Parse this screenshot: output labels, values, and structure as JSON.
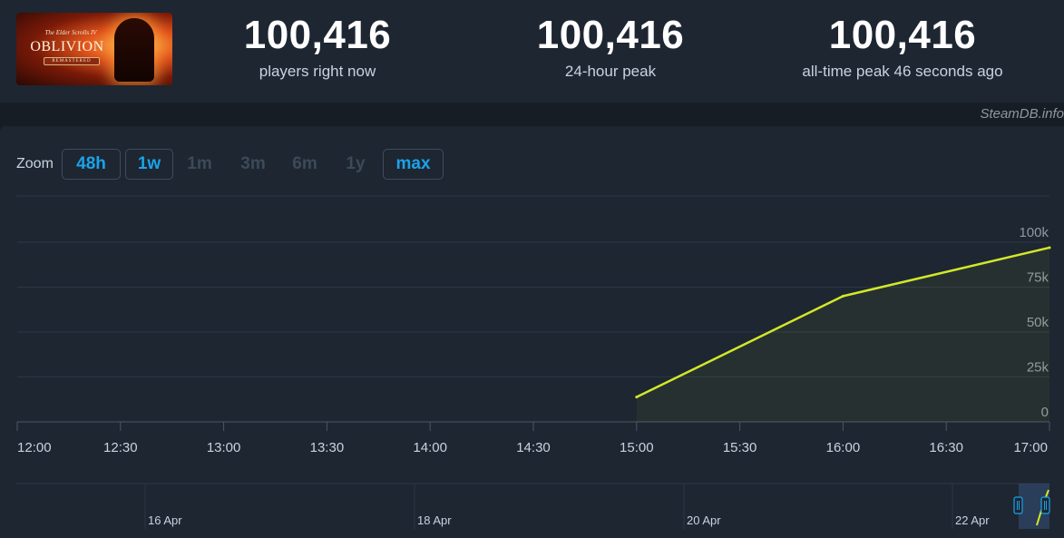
{
  "game": {
    "logo_small": "The Elder Scrolls IV",
    "logo_main": "OBLIVION",
    "logo_badge": "REMASTERED"
  },
  "stats": [
    {
      "value": "100,416",
      "label": "players right now"
    },
    {
      "value": "100,416",
      "label": "24-hour peak"
    },
    {
      "value": "100,416",
      "label": "all-time peak 46 seconds ago"
    }
  ],
  "credit": "SteamDB.info",
  "zoom": {
    "label": "Zoom",
    "buttons": [
      {
        "label": "48h",
        "active": true
      },
      {
        "label": "1w",
        "active": true
      },
      {
        "label": "1m",
        "active": false
      },
      {
        "label": "3m",
        "active": false
      },
      {
        "label": "6m",
        "active": false
      },
      {
        "label": "1y",
        "active": false
      },
      {
        "label": "max",
        "active": true
      }
    ]
  },
  "colors": {
    "line": "#d2e829",
    "accent": "#1aa3e8",
    "grid": "#2c3744"
  },
  "chart_data": {
    "type": "line",
    "title": "",
    "xlabel": "",
    "ylabel": "",
    "x_ticks": [
      "12:00",
      "12:30",
      "13:00",
      "13:30",
      "14:00",
      "14:30",
      "15:00",
      "15:30",
      "16:00",
      "16:30",
      "17:00"
    ],
    "y_ticks": [
      "0",
      "25k",
      "50k",
      "75k",
      "100k"
    ],
    "ylim": [
      0,
      100000
    ],
    "xlim_hours": [
      12,
      17
    ],
    "series": [
      {
        "x": [
          15.0,
          16.0,
          17.0
        ],
        "y": [
          13800,
          70000,
          97000
        ]
      }
    ],
    "navigator": {
      "labels": [
        "16 Apr",
        "18 Apr",
        "20 Apr",
        "22 Apr"
      ]
    },
    "grid": true,
    "legend": "none"
  }
}
